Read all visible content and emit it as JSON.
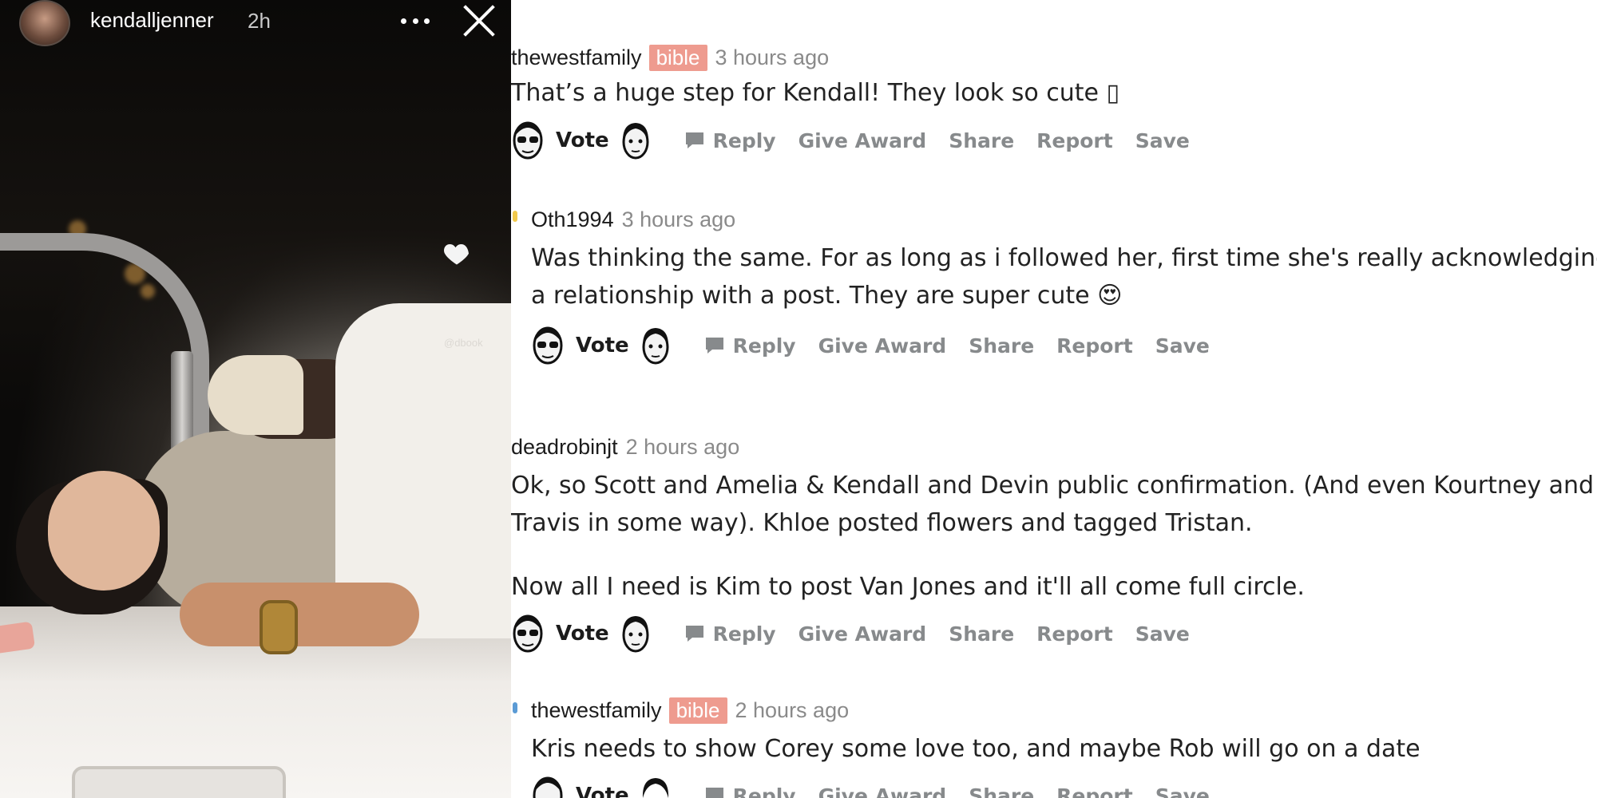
{
  "story": {
    "username": "kendalljenner",
    "time": "2h",
    "credit": "@dbook"
  },
  "comments": [
    {
      "author": "thewestfamily",
      "flair": "bible",
      "ago": "3 hours ago",
      "body": [
        "That’s a huge step for Kendall! They look so cute ▯"
      ]
    },
    {
      "author": "Oth1994",
      "flair": "",
      "ago": "3 hours ago",
      "body": [
        "Was thinking the same. For as long as i followed her, first time she's really acknowledging",
        "a relationship with a post. They are super cute 😍"
      ]
    },
    {
      "author": "deadrobinjt",
      "flair": "",
      "ago": "2 hours ago",
      "body": [
        "Ok, so Scott and Amelia & Kendall and Devin public confirmation. (And even Kourtney and",
        "Travis in some way). Khloe posted flowers and tagged Tristan.",
        "Now all I need is Kim to post Van Jones and it'll all come full circle."
      ]
    },
    {
      "author": "thewestfamily",
      "flair": "bible",
      "ago": "2 hours ago",
      "body": [
        "Kris needs to show Corey some love too, and maybe Rob will go on a date"
      ]
    }
  ],
  "actions": {
    "vote": "Vote",
    "reply": "Reply",
    "give_award": "Give Award",
    "share": "Share",
    "report": "Report",
    "save": "Save"
  },
  "icons": {
    "story_more": "more-horizontal-icon",
    "story_close": "close-icon",
    "sticker": "heart-icon",
    "reply": "comment-bubble-icon",
    "upvote": "upvote-face-icon",
    "downvote": "downvote-face-icon"
  },
  "colors": {
    "flair_bg": "#ee9b8f",
    "action_gray": "#878a8c",
    "text": "#222222"
  }
}
